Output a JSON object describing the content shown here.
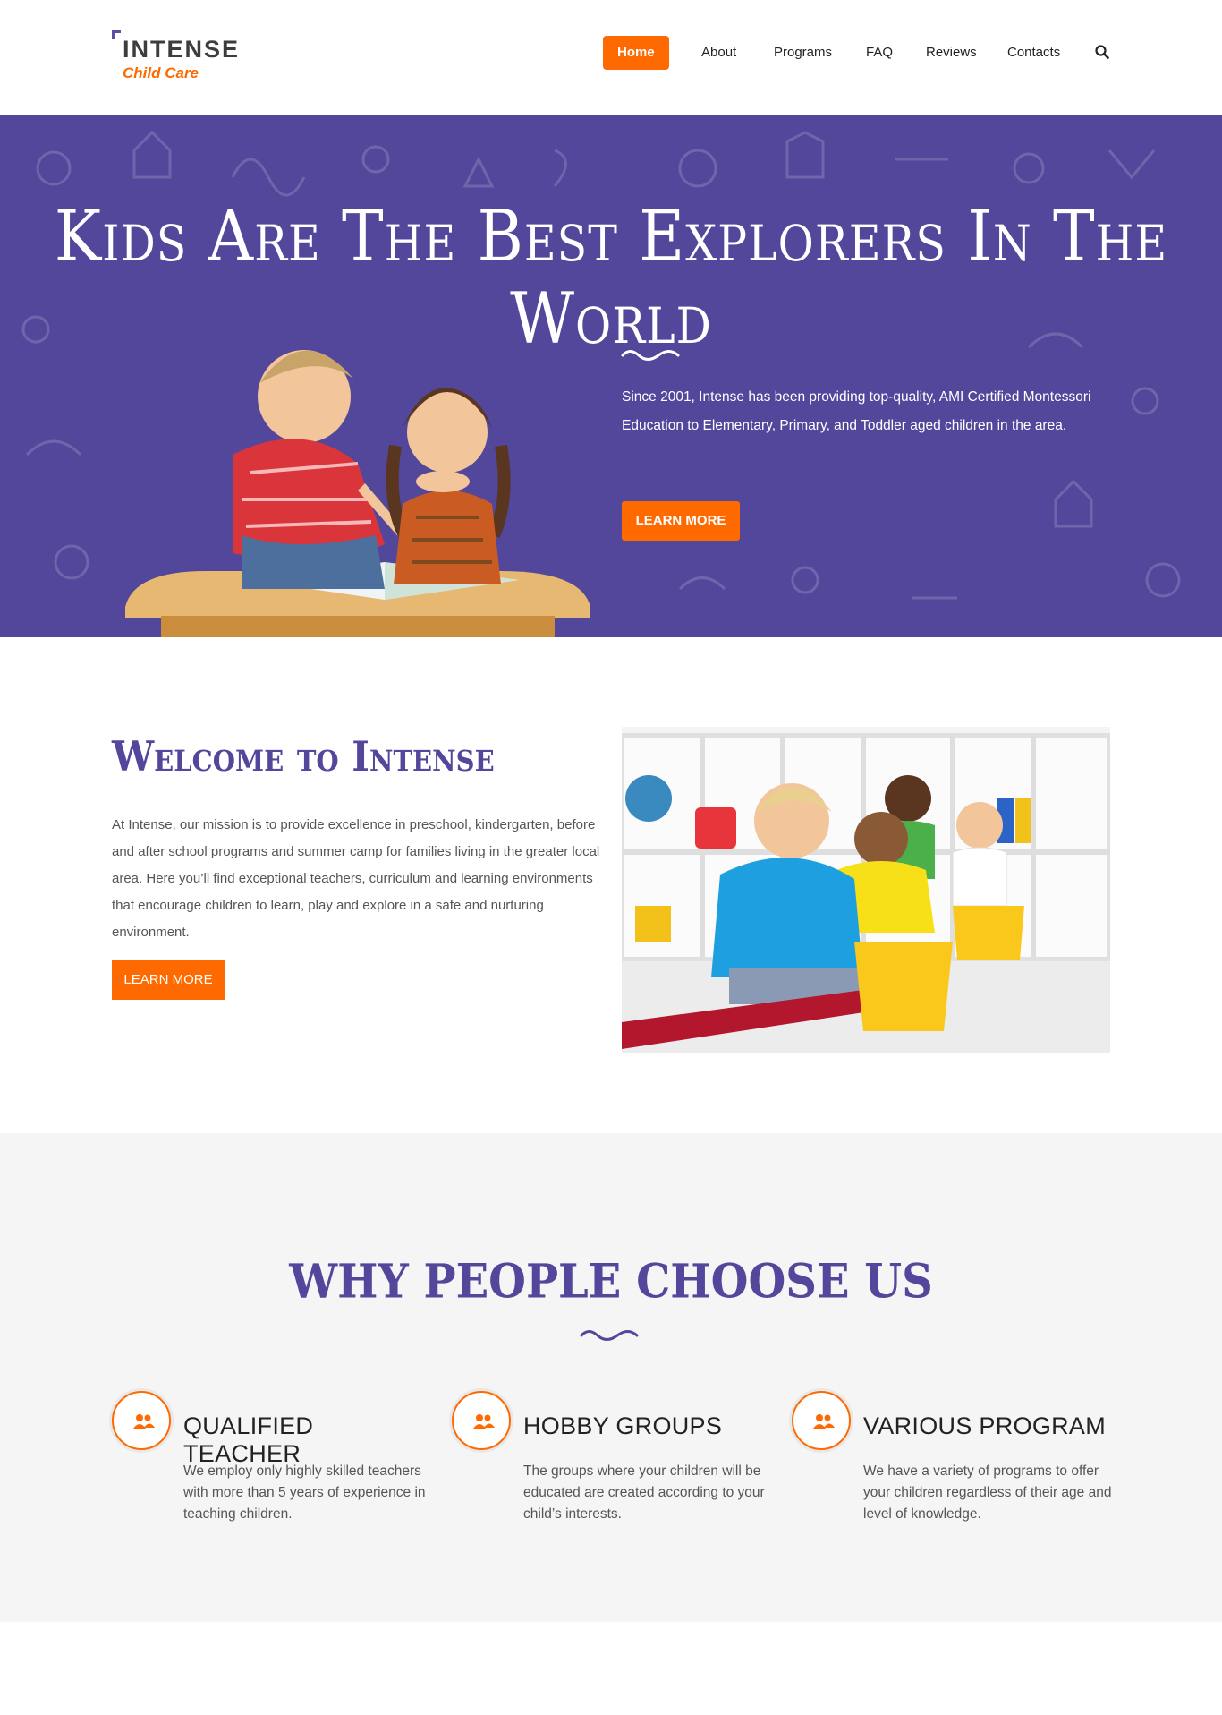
{
  "brand": {
    "name": "INTENSE",
    "tagline": "Child Care",
    "accent_color": "#ff6a00",
    "primary_color": "#52479b"
  },
  "nav": {
    "items": [
      {
        "label": "Home",
        "active": true
      },
      {
        "label": "About",
        "active": false
      },
      {
        "label": "Programs",
        "active": false
      },
      {
        "label": "FAQ",
        "active": false
      },
      {
        "label": "Reviews",
        "active": false
      },
      {
        "label": "Contacts",
        "active": false
      }
    ],
    "search_icon": "search-icon"
  },
  "hero": {
    "title": "Kids Are The Best Explorers In The World",
    "text": "Since 2001, Intense has been providing top-quality, AMI Certified Montessori Education to Elementary, Primary, and Toddler aged children in the area.",
    "button": "LEARN MORE"
  },
  "welcome": {
    "title": "Welcome to Intense",
    "text": "At Intense, our mission is to provide excellence in preschool, kindergarten, before and after school programs and summer camp for families living in the greater local area. Here you’ll find exceptional teachers, curriculum and learning environments that encourage children to learn, play and explore in a safe and nurturing environment.",
    "button": "LEARN MORE"
  },
  "why": {
    "title": "WHY PEOPLE CHOOSE US",
    "features": [
      {
        "icon": "users-icon",
        "title": "QUALIFIED TEACHER",
        "text": "We employ only highly skilled teachers with more than 5 years of experience in teaching children."
      },
      {
        "icon": "users-icon",
        "title": "HOBBY GROUPS",
        "text": "The groups where your children will be educated are created according to your child’s interests."
      },
      {
        "icon": "users-icon",
        "title": "VARIOUS PROGRAM",
        "text": "We have a variety of programs to offer your children regardless of their age and level of knowledge."
      }
    ]
  }
}
